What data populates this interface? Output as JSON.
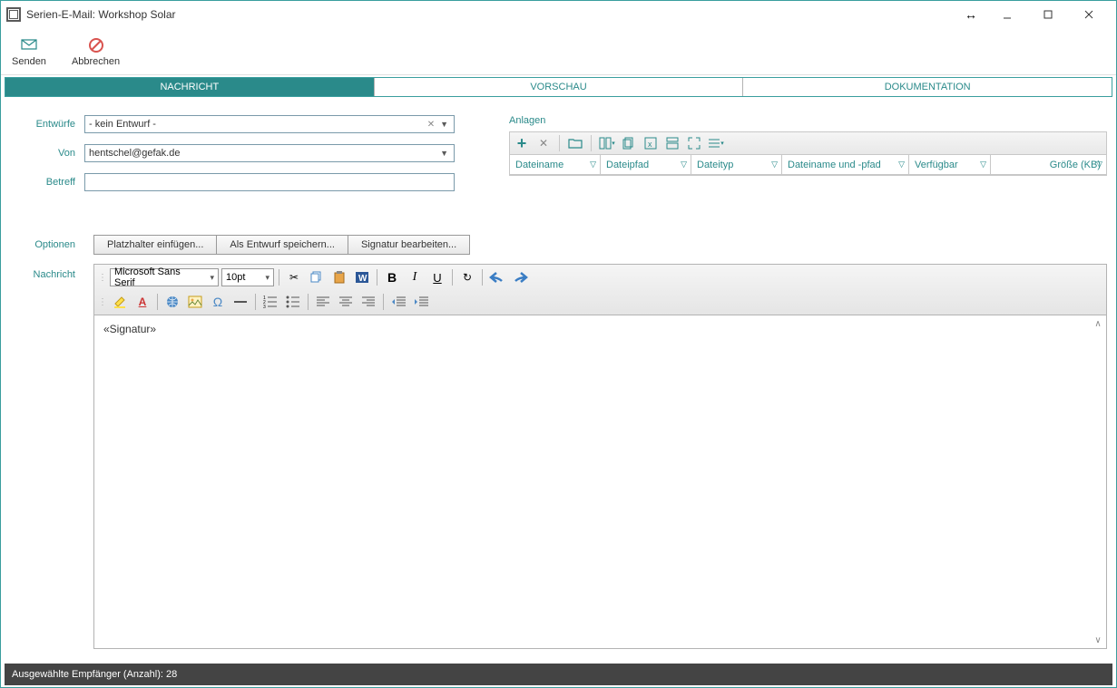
{
  "window": {
    "title": "Serien-E-Mail: Workshop Solar"
  },
  "toolbar": {
    "send": "Senden",
    "cancel": "Abbrechen"
  },
  "tabs": {
    "message": "NACHRICHT",
    "preview": "VORSCHAU",
    "documentation": "DOKUMENTATION"
  },
  "form": {
    "drafts_label": "Entwürfe",
    "drafts_value": "- kein Entwurf -",
    "from_label": "Von",
    "from_value": "hentschel@gefak.de",
    "subject_label": "Betreff"
  },
  "attachments": {
    "label": "Anlagen",
    "columns": {
      "filename": "Dateiname",
      "filepath": "Dateipfad",
      "filetype": "Dateityp",
      "fullpath": "Dateiname und -pfad",
      "available": "Verfügbar",
      "size": "Größe (KB)"
    }
  },
  "options": {
    "label": "Optionen",
    "placeholder": "Platzhalter einfügen...",
    "save_draft": "Als Entwurf speichern...",
    "edit_signature": "Signatur bearbeiten..."
  },
  "editor": {
    "label": "Nachricht",
    "font": "Microsoft Sans Serif",
    "size": "10pt",
    "body": "«Signatur»"
  },
  "status": {
    "text": "Ausgewählte Empfänger (Anzahl): 28"
  }
}
